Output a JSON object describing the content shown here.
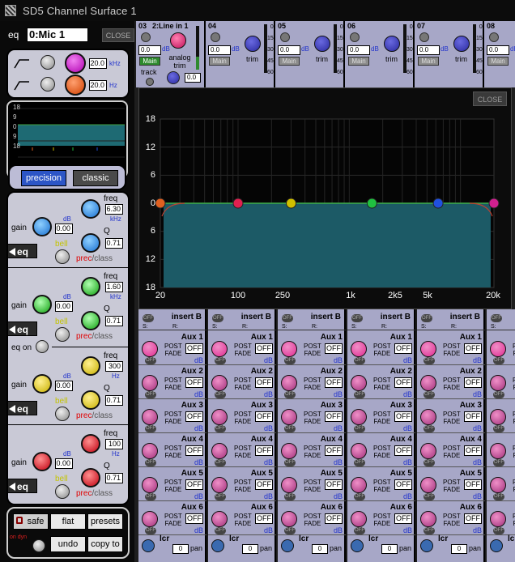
{
  "window": {
    "title": "SD5 Channel Surface 1"
  },
  "eq_panel": {
    "label": "eq",
    "channel_name": "0:Mic 1",
    "close_label": "CLOSE",
    "hpf": {
      "value": "20.0",
      "unit": "kHz"
    },
    "lpf": {
      "value": "20.0",
      "unit": "Hz"
    },
    "mini_graph": {
      "y_ticks": [
        "18",
        "9",
        "0",
        "9",
        "18"
      ],
      "x_ticks": [
        "20",
        "100",
        "1k",
        "5k",
        "20k"
      ]
    },
    "modes": {
      "precision": "precision",
      "classic": "classic"
    },
    "bands": [
      {
        "freq_label": "freq",
        "freq": "6.30",
        "freq_unit": "kHz",
        "gain_label": "gain",
        "gain_unit": "dB",
        "gain": "0.00",
        "q_label": "Q",
        "q": "0.71",
        "eq_label": "eq",
        "bell_label": "bell",
        "prec": "prec",
        "slash": "/",
        "class": "class",
        "color": "#3aa0ff"
      },
      {
        "freq_label": "freq",
        "freq": "1.60",
        "freq_unit": "kHz",
        "gain_label": "gain",
        "gain_unit": "dB",
        "gain": "0.00",
        "q_label": "Q",
        "q": "0.71",
        "eq_label": "eq",
        "bell_label": "bell",
        "prec": "prec",
        "slash": "/",
        "class": "class",
        "color": "#33cc33"
      },
      {
        "freq_label": "freq",
        "freq": "300",
        "freq_unit": "Hz",
        "gain_label": "gain",
        "gain_unit": "dB",
        "gain": "0.00",
        "q_label": "Q",
        "q": "0.71",
        "eq_label": "eq",
        "bell_label": "bell",
        "prec": "prec",
        "slash": "/",
        "class": "class",
        "color": "#e0d000"
      },
      {
        "freq_label": "freq",
        "freq": "100",
        "freq_unit": "Hz",
        "gain_label": "gain",
        "gain_unit": "dB",
        "gain": "0.00",
        "q_label": "Q",
        "q": "0.71",
        "eq_label": "eq",
        "bell_label": "bell",
        "prec": "prec",
        "slash": "/",
        "class": "class",
        "color": "#e02020"
      }
    ],
    "eq_on_label": "eq on",
    "buttons": {
      "safe": "safe",
      "flat": "flat",
      "presets": "presets",
      "undo": "undo",
      "copy_to": "copy to",
      "on_dyn": "on dyn"
    }
  },
  "top_channels": [
    {
      "num": "03",
      "name": "2:Line in 1",
      "value": "0.0",
      "unit": "dB",
      "main": "Main",
      "analog_trim_label": "analog trim",
      "track_label": "track",
      "trim_value": "0.0"
    },
    {
      "num": "04",
      "value": "0.0",
      "unit": "dB",
      "main": "Main",
      "trim_label": "trim"
    },
    {
      "num": "05",
      "value": "0.0",
      "unit": "dB",
      "main": "Main",
      "trim_label": "trim"
    },
    {
      "num": "06",
      "value": "0.0",
      "unit": "dB",
      "main": "Main",
      "trim_label": "trim"
    },
    {
      "num": "07",
      "value": "0.0",
      "unit": "dB",
      "main": "Main",
      "trim_label": "trim"
    },
    {
      "num": "08",
      "value": "0.0",
      "unit": "dB",
      "main": "Main"
    }
  ],
  "meter_scale": [
    "0",
    "15",
    "30",
    "45",
    "60"
  ],
  "big_eq": {
    "close_label": "CLOSE",
    "y_ticks": [
      "18",
      "12",
      "6",
      "0",
      "6",
      "12",
      "18"
    ],
    "x_ticks": [
      "20",
      "100",
      "250",
      "1k",
      "2k5",
      "5k",
      "20k"
    ],
    "nodes": [
      {
        "freq": 20,
        "color": "#e06020"
      },
      {
        "freq": 100,
        "color": "#e02050"
      },
      {
        "freq": 300,
        "color": "#d0c000"
      },
      {
        "freq": 1600,
        "color": "#20c040"
      },
      {
        "freq": 6300,
        "color": "#2050e0"
      },
      {
        "freq": 20000,
        "color": "#d02090"
      }
    ]
  },
  "insert_label": "insert B",
  "off_label": "OFF",
  "s_label": "S:",
  "r_label": "R:",
  "post_label": "POST",
  "fade_label": "FADE",
  "db_label": "dB",
  "aux_names": [
    "Aux 1",
    "Aux 2",
    "Aux 3",
    "Aux 4",
    "Aux 5",
    "Aux 6"
  ],
  "lcr": {
    "label": "lcr",
    "value": "0",
    "pan_label": "pan"
  }
}
